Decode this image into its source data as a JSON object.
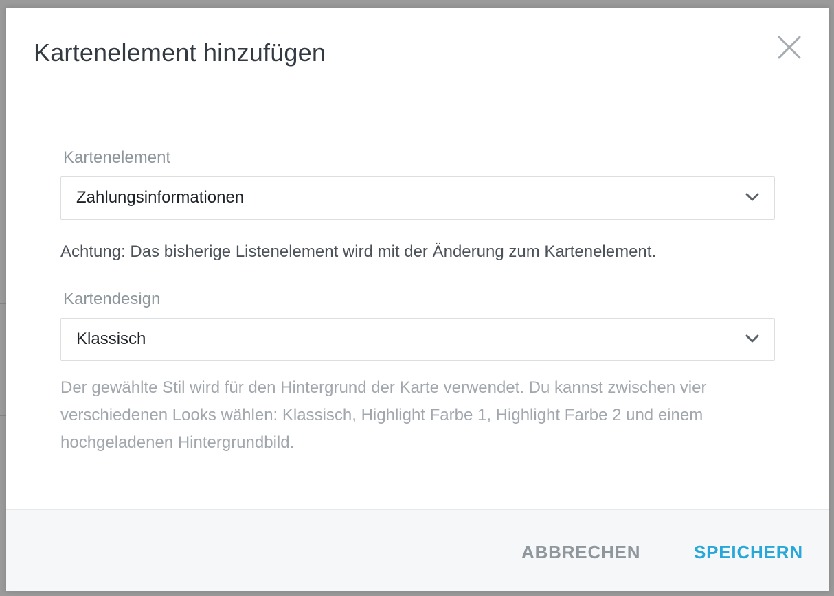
{
  "dialog": {
    "title": "Kartenelement hinzufügen",
    "close_icon": "close-icon"
  },
  "fields": {
    "card_element": {
      "label": "Kartenelement",
      "value": "Zahlungsinformationen",
      "icon": "chevron-down-icon"
    },
    "warning_note": "Achtung: Das bisherige Listenelement wird mit der Änderung zum Kartenelement.",
    "card_design": {
      "label": "Kartendesign",
      "value": "Klassisch",
      "icon": "chevron-down-icon"
    },
    "design_help": "Der gewählte Stil wird für den Hintergrund der Karte verwendet. Du kannst zwischen vier verschiedenen Looks wählen: Klassisch, Highlight Farbe 1, Highlight Farbe 2 und einem hochgeladenen Hintergrundbild."
  },
  "footer": {
    "cancel_label": "ABBRECHEN",
    "save_label": "SPEICHERN"
  },
  "colors": {
    "accent": "#29a7d8",
    "cancel": "#8f969c",
    "overlay": "#9a9a9a"
  }
}
